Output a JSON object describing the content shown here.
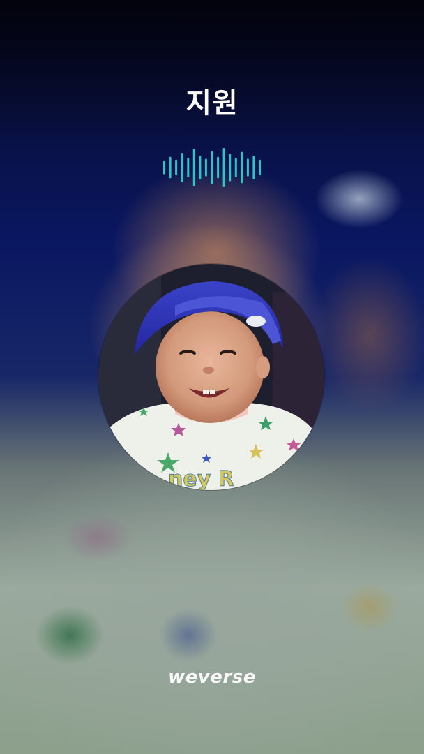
{
  "call": {
    "name": "지원"
  },
  "voice_indicator": {
    "icon": "audio-waveform-icon",
    "color": "#2cc4c9",
    "levels": [
      0.35,
      0.55,
      0.4,
      0.75,
      0.5,
      0.95,
      0.6,
      0.45,
      0.85,
      0.55,
      1.0,
      0.7,
      0.5,
      0.8,
      0.45,
      0.6,
      0.4
    ]
  },
  "profile": {
    "icon": "profile-photo"
  },
  "brand": {
    "logo_text": "weverse"
  }
}
